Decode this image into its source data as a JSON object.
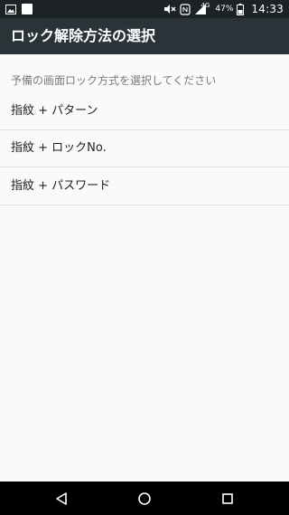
{
  "status_bar": {
    "battery_percent": "47%",
    "network_type": "4G",
    "time": "14:33",
    "icons": [
      "image-icon",
      "notification-square-icon",
      "mute-icon",
      "nfc-icon",
      "signal-icon",
      "battery-icon"
    ]
  },
  "app_bar": {
    "title": "ロック解除方法の選択"
  },
  "content": {
    "section_header": "予備の画面ロック方式を選択してください",
    "options": [
      {
        "label": "指紋 + パターン"
      },
      {
        "label": "指紋 + ロックNo."
      },
      {
        "label": "指紋 + パスワード"
      }
    ]
  },
  "nav_bar": {
    "icons": [
      "back-icon",
      "home-icon",
      "recents-icon"
    ]
  },
  "colors": {
    "status_bar_bg": "#1c2226",
    "app_bar_bg": "#2a3338",
    "content_bg": "#fafafa",
    "divider": "#e2e2e2",
    "header_text": "#7b7b7b",
    "body_text": "#222222",
    "nav_bar_bg": "#000000"
  }
}
